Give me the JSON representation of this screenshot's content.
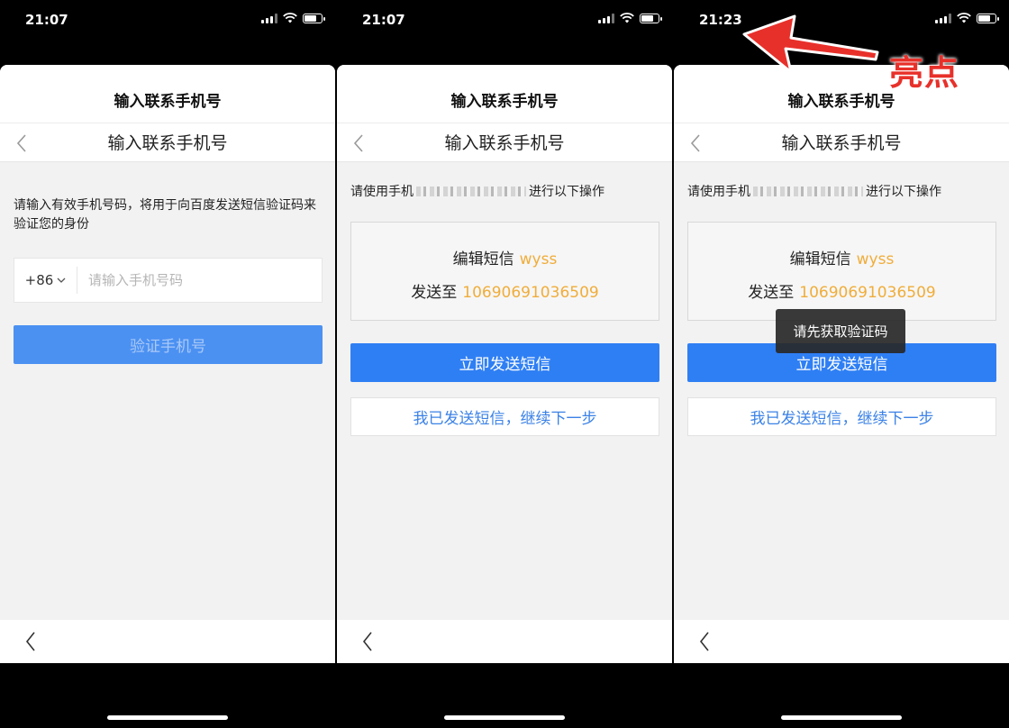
{
  "screens": [
    {
      "time": "21:07",
      "sheet_title": "输入联系手机号",
      "nav_title": "输入联系手机号",
      "hint": "请输入有效手机号码，将用于向百度发送短信验证码来验证您的身份",
      "country_code": "+86",
      "phone_placeholder": "请输入手机号码",
      "verify_button": "验证手机号"
    },
    {
      "time": "21:07",
      "sheet_title": "输入联系手机号",
      "nav_title": "输入联系手机号",
      "use_phone_prefix": "请使用手机",
      "use_phone_suffix": "进行以下操作",
      "edit_sms_label": "编辑短信",
      "sms_code": "wyss",
      "send_to_label": "发送至",
      "sms_number": "10690691036509",
      "send_button": "立即发送短信",
      "sent_button": "我已发送短信，继续下一步"
    },
    {
      "time": "21:23",
      "sheet_title": "输入联系手机号",
      "nav_title": "输入联系手机号",
      "use_phone_prefix": "请使用手机",
      "use_phone_suffix": "进行以下操作",
      "edit_sms_label": "编辑短信",
      "sms_code": "wyss",
      "send_to_label": "发送至",
      "sms_number": "10690691036509",
      "send_button": "立即发送短信",
      "sent_button": "我已发送短信，继续下一步",
      "toast": "请先获取验证码"
    }
  ],
  "annotation": {
    "label": "亮点",
    "color": "#e8302a"
  },
  "colors": {
    "primary": "#2f7ff4",
    "accent": "#f0ad3a",
    "link": "#3b82e6"
  }
}
